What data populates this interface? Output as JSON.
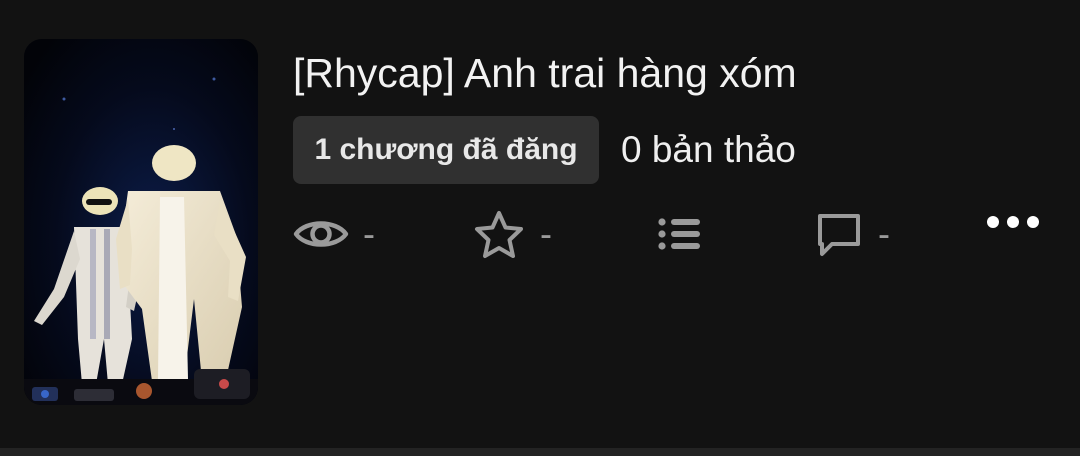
{
  "story": {
    "title": "[Rhycap] Anh trai hàng xóm",
    "published_badge": "1 chương đã đăng",
    "drafts": "0 bản thảo",
    "stats": {
      "views": "-",
      "votes": "-",
      "comments": "-"
    }
  },
  "icons": {
    "views": "eye-icon",
    "votes": "star-icon",
    "parts": "list-icon",
    "comments": "comment-icon",
    "more": "more-dots-icon"
  },
  "colors": {
    "background": "#121212",
    "badge_background": "#303030",
    "icon_gray": "#9a9a9a",
    "text_primary": "#f2f2f2"
  }
}
